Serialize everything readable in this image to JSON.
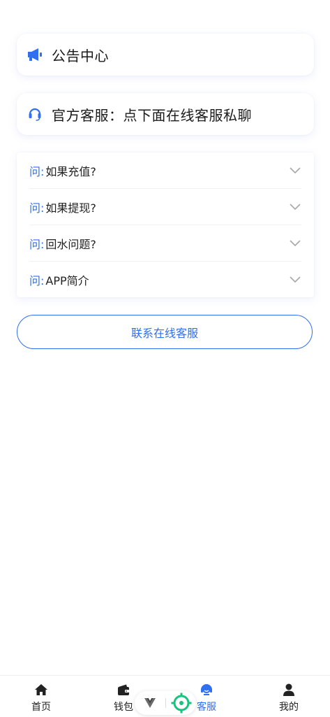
{
  "notice": {
    "title": "公告中心",
    "icon": "megaphone-icon"
  },
  "service": {
    "title": "官方客服：点下面在线客服私聊",
    "icon": "headset-icon"
  },
  "faq": {
    "prefix": "问:",
    "items": [
      {
        "question": "如果充值?"
      },
      {
        "question": "如果提现?"
      },
      {
        "question": "回水问题?"
      },
      {
        "question": "APP简介"
      }
    ]
  },
  "contact_button": {
    "label": "联系在线客服"
  },
  "tabbar": {
    "items": [
      {
        "label": "首页",
        "icon": "home-icon",
        "active": false
      },
      {
        "label": "钱包",
        "icon": "wallet-icon",
        "active": false
      },
      {
        "label": "客服",
        "icon": "customer-service-icon",
        "active": true
      },
      {
        "label": "我的",
        "icon": "user-icon",
        "active": false
      }
    ]
  },
  "floating_tool": {
    "left_icon": "vue-logo-icon",
    "right_icon": "crosshair-target-icon"
  },
  "colors": {
    "accent": "#2f6ff0",
    "target_green": "#19c37d"
  }
}
